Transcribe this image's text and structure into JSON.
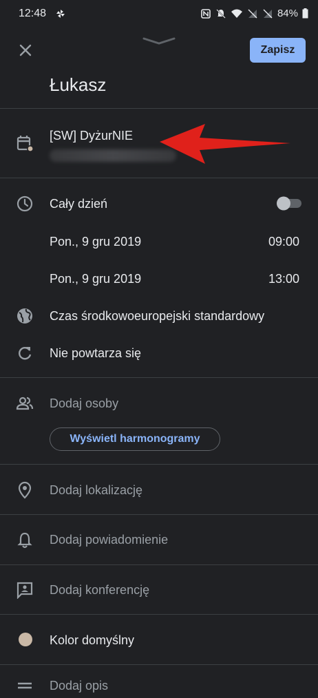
{
  "status": {
    "time": "12:48",
    "battery": "84%"
  },
  "header": {
    "save_label": "Zapisz",
    "title": "Łukasz"
  },
  "calendar": {
    "name": "[SW] DyżurNIE"
  },
  "time": {
    "all_day_label": "Cały dzień",
    "start_date": "Pon., 9 gru 2019",
    "start_time": "09:00",
    "end_date": "Pon., 9 gru 2019",
    "end_time": "13:00",
    "timezone": "Czas środkowoeuropejski standardowy",
    "repeat": "Nie powtarza się"
  },
  "people": {
    "add_label": "Dodaj osoby",
    "schedules_button": "Wyświetl harmonogramy"
  },
  "location": {
    "add_label": "Dodaj lokalizację"
  },
  "notification": {
    "add_label": "Dodaj powiadomienie"
  },
  "conference": {
    "add_label": "Dodaj konferencję"
  },
  "color": {
    "label": "Kolor domyślny",
    "swatch": "#c9b8a6"
  },
  "description": {
    "add_label": "Dodaj opis"
  },
  "annotation": {
    "arrow_color": "#e0211b"
  }
}
